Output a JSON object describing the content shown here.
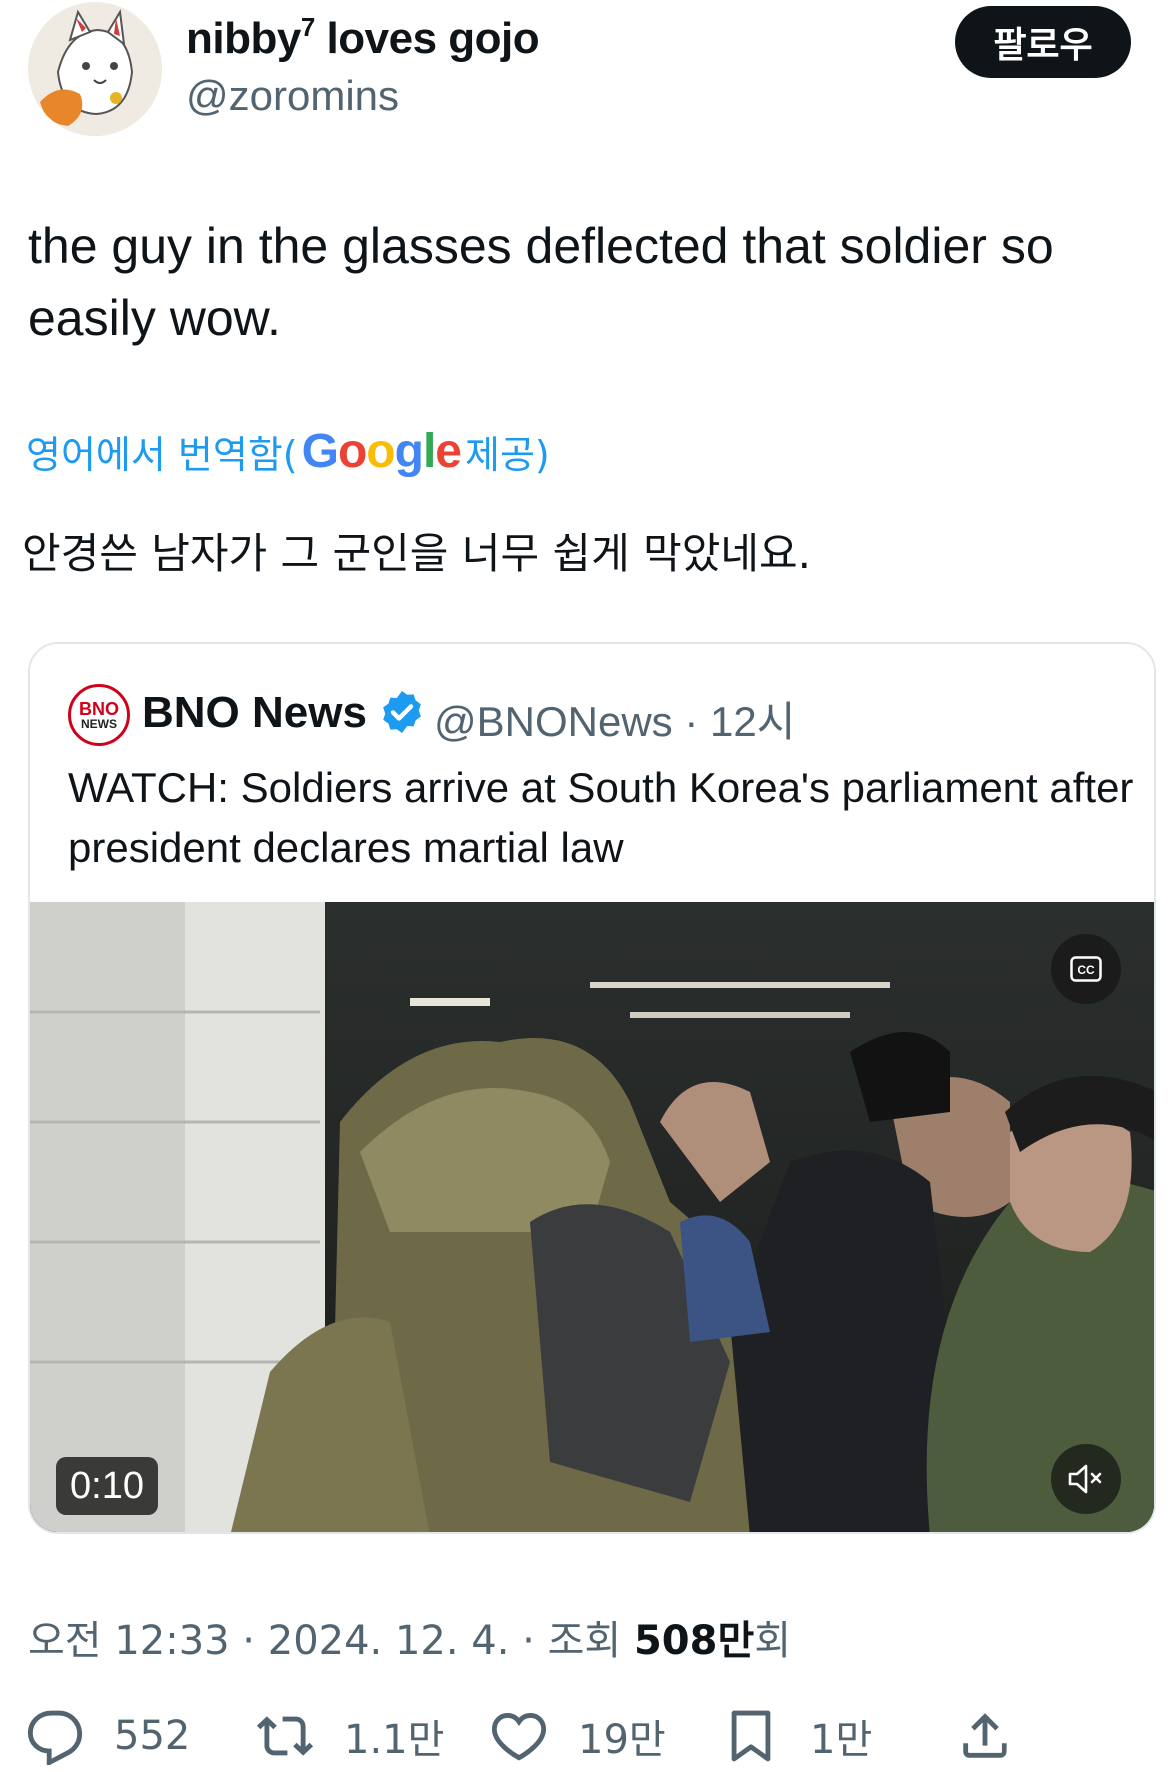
{
  "author": {
    "display_name": "nibby",
    "name_superscript": "7",
    "name_suffix": " loves gojo",
    "handle": "@zoromins"
  },
  "follow_button": {
    "label": "팔로우"
  },
  "tweet": {
    "text": "the guy in the glasses deflected that soldier so easily wow.",
    "translate_prefix": "영어에서 번역함(",
    "translate_brand": "Google",
    "translate_suffix": " 제공)",
    "translated_text": "안경쓴 남자가 그 군인을 너무 쉽게 막았네요."
  },
  "quoted_tweet": {
    "avatar_top": "BNO",
    "avatar_bottom": "NEWS",
    "name": "BNO News",
    "handle": "@BNONews",
    "time": "12시",
    "text": "WATCH: Soldiers arrive at South Korea's parliament after president declares martial law",
    "video": {
      "duration": "0:10",
      "cc_icon": "cc-icon",
      "mute_icon": "muted-speaker-icon"
    }
  },
  "meta": {
    "time": "오전 12:33",
    "date": "2024. 12. 4.",
    "views_label": "조회",
    "views_count": "508만",
    "views_suffix": "회"
  },
  "actions": {
    "replies": "552",
    "reposts": "1.1만",
    "likes": "19만",
    "bookmarks": "1만"
  },
  "colors": {
    "accent": "#1d9bf0",
    "verified": "#1d9bf0",
    "text_primary": "#0f1419",
    "text_secondary": "#536471"
  }
}
